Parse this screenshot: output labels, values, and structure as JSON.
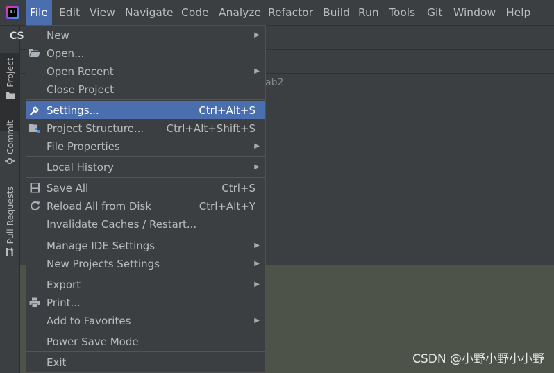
{
  "menubar": {
    "items": [
      {
        "label": "File",
        "active": true
      },
      {
        "label": "Edit"
      },
      {
        "label": "View"
      },
      {
        "label": "Navigate"
      },
      {
        "label": "Code"
      },
      {
        "label": "Analyze"
      },
      {
        "label": "Refactor"
      },
      {
        "label": "Build"
      },
      {
        "label": "Run"
      },
      {
        "label": "Tools"
      },
      {
        "label": "Git"
      },
      {
        "label": "Window"
      },
      {
        "label": "Help"
      }
    ]
  },
  "project_short": "CS",
  "tree_fragment": "ab2",
  "tool_stripe": {
    "tabs": [
      {
        "label": "Project",
        "icon": "folder-icon"
      },
      {
        "label": "Commit",
        "icon": "commit-icon"
      },
      {
        "label": "Pull Requests",
        "icon": "pull-request-icon"
      }
    ]
  },
  "file_menu": {
    "items": [
      {
        "label": "New",
        "submenu": true
      },
      {
        "label": "Open...",
        "icon": "folder-open-icon"
      },
      {
        "label": "Open Recent",
        "submenu": true
      },
      {
        "label": "Close Project"
      },
      {
        "label": "Settings...",
        "shortcut": "Ctrl+Alt+S",
        "icon": "wrench-icon",
        "highlighted": true
      },
      {
        "label": "Project Structure...",
        "shortcut": "Ctrl+Alt+Shift+S",
        "icon": "project-structure-icon"
      },
      {
        "label": "File Properties",
        "submenu": true
      },
      {
        "label": "Local History",
        "submenu": true
      },
      {
        "label": "Save All",
        "shortcut": "Ctrl+S",
        "icon": "save-icon"
      },
      {
        "label": "Reload All from Disk",
        "shortcut": "Ctrl+Alt+Y",
        "icon": "reload-icon"
      },
      {
        "label": "Invalidate Caches / Restart..."
      },
      {
        "label": "Manage IDE Settings",
        "submenu": true
      },
      {
        "label": "New Projects Settings",
        "submenu": true
      },
      {
        "label": "Export",
        "submenu": true
      },
      {
        "label": "Print...",
        "icon": "print-icon"
      },
      {
        "label": "Add to Favorites",
        "submenu": true
      },
      {
        "label": "Power Save Mode"
      },
      {
        "label": "Exit"
      }
    ]
  },
  "watermark": "CSDN @小野小野小小野",
  "colors": {
    "background": "#3c3f41",
    "highlight": "#4b6eaf",
    "editor": "#4d5349"
  }
}
